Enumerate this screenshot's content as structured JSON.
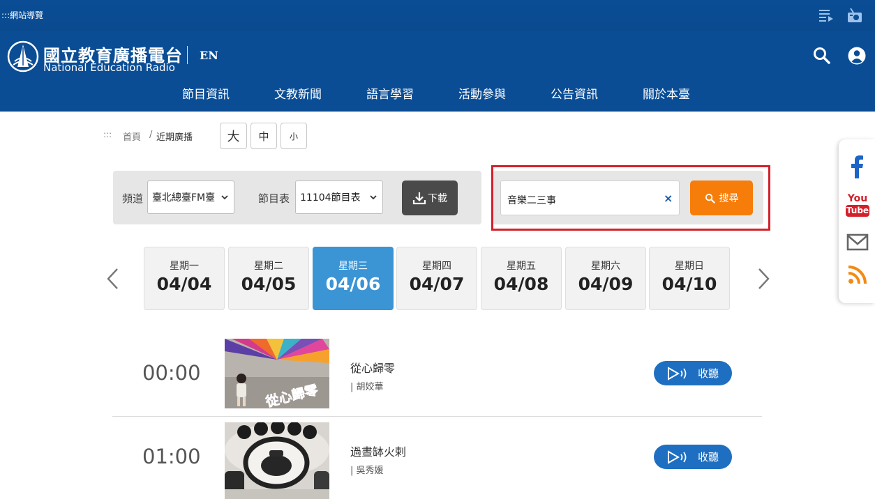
{
  "topbar": {
    "nav_guide": ":::網站導覽",
    "playlist_icon": "playlist-icon",
    "radio_icon": "radio-icon"
  },
  "header": {
    "logo_zh": "國立教育廣播電台",
    "logo_en": "National Education Radio",
    "lang": "EN",
    "search_icon": "search-icon",
    "user_icon": "user-icon",
    "nav": [
      "節目資訊",
      "文教新聞",
      "語言學習",
      "活動參與",
      "公告資訊",
      "關於本臺"
    ]
  },
  "breadcrumb": {
    "marker": ":::",
    "home": "首頁",
    "separator": "/",
    "current": "近期廣播"
  },
  "font_size": {
    "large": "大",
    "medium": "中",
    "small": "小"
  },
  "filters": {
    "channel_label": "頻道",
    "channel_value": "臺北總臺FM臺",
    "schedule_label": "節目表",
    "schedule_value": "11104節目表",
    "download_label": "下載",
    "search_value": "音樂二三事",
    "clear_label": "×",
    "search_button": "搜尋"
  },
  "days": [
    {
      "name": "星期一",
      "date": "04/04",
      "active": false
    },
    {
      "name": "星期二",
      "date": "04/05",
      "active": false
    },
    {
      "name": "星期三",
      "date": "04/06",
      "active": true
    },
    {
      "name": "星期四",
      "date": "04/07",
      "active": false
    },
    {
      "name": "星期五",
      "date": "04/08",
      "active": false
    },
    {
      "name": "星期六",
      "date": "04/09",
      "active": false
    },
    {
      "name": "星期日",
      "date": "04/10",
      "active": false
    }
  ],
  "programs": [
    {
      "time": "00:00",
      "title": "從心歸零",
      "host": "| 胡姣華",
      "thumb_text": "從心歸零",
      "listen": "收聽"
    },
    {
      "time": "01:00",
      "title": "過晝缽火剌",
      "host": "| 吳秀媛",
      "listen": "收聽"
    }
  ],
  "social": {
    "youtube_you": "You",
    "youtube_tube": "Tube",
    "icons": [
      "facebook-icon",
      "youtube-icon",
      "mail-icon",
      "rss-icon"
    ]
  },
  "colors": {
    "header_blue": "#0a4d95",
    "active_day": "#3b94d4",
    "search_orange": "#f77d0a",
    "listen_blue": "#1e6fc1",
    "highlight_red": "#d4202a"
  }
}
